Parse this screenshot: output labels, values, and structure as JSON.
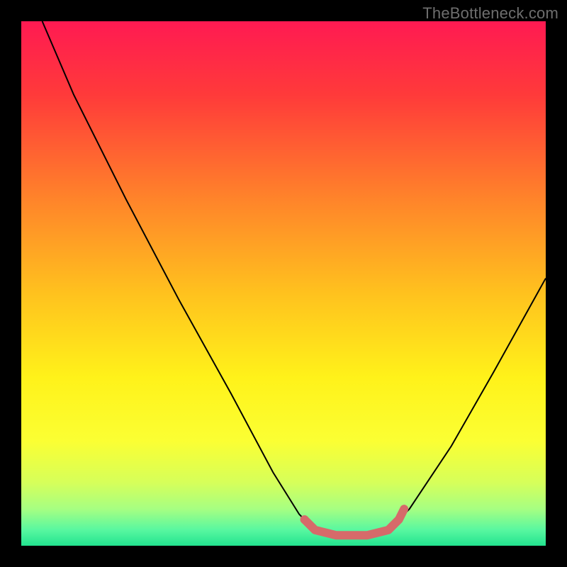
{
  "attribution": "TheBottleneck.com",
  "chart_data": {
    "type": "line",
    "title": "",
    "xlabel": "",
    "ylabel": "",
    "xlim": [
      0,
      100
    ],
    "ylim": [
      0,
      100
    ],
    "gradient_stops": [
      {
        "pct": 0,
        "color": "#ff1a52"
      },
      {
        "pct": 14,
        "color": "#ff3a3a"
      },
      {
        "pct": 34,
        "color": "#ff842a"
      },
      {
        "pct": 52,
        "color": "#ffc21e"
      },
      {
        "pct": 68,
        "color": "#fff21a"
      },
      {
        "pct": 80,
        "color": "#fbff33"
      },
      {
        "pct": 88,
        "color": "#d6ff5a"
      },
      {
        "pct": 93,
        "color": "#a6ff82"
      },
      {
        "pct": 97,
        "color": "#58f7a0"
      },
      {
        "pct": 100,
        "color": "#22e38f"
      }
    ],
    "series": [
      {
        "name": "bottleneck-curve",
        "stroke": "#000000",
        "stroke_width": 2,
        "points": [
          {
            "x": 4,
            "y": 100
          },
          {
            "x": 10,
            "y": 86
          },
          {
            "x": 20,
            "y": 66
          },
          {
            "x": 30,
            "y": 47
          },
          {
            "x": 40,
            "y": 29
          },
          {
            "x": 48,
            "y": 14
          },
          {
            "x": 53,
            "y": 6
          },
          {
            "x": 56,
            "y": 3
          },
          {
            "x": 60,
            "y": 2
          },
          {
            "x": 66,
            "y": 2
          },
          {
            "x": 70,
            "y": 3
          },
          {
            "x": 74,
            "y": 7
          },
          {
            "x": 82,
            "y": 19
          },
          {
            "x": 90,
            "y": 33
          },
          {
            "x": 100,
            "y": 51
          }
        ]
      },
      {
        "name": "highlight-band",
        "stroke": "#d66a6a",
        "stroke_width": 12,
        "points": [
          {
            "x": 54,
            "y": 5
          },
          {
            "x": 56,
            "y": 3
          },
          {
            "x": 60,
            "y": 2
          },
          {
            "x": 66,
            "y": 2
          },
          {
            "x": 70,
            "y": 3
          },
          {
            "x": 72,
            "y": 5
          },
          {
            "x": 73,
            "y": 7
          }
        ],
        "marker": {
          "x": 54,
          "y": 5,
          "r": 6
        }
      }
    ]
  }
}
